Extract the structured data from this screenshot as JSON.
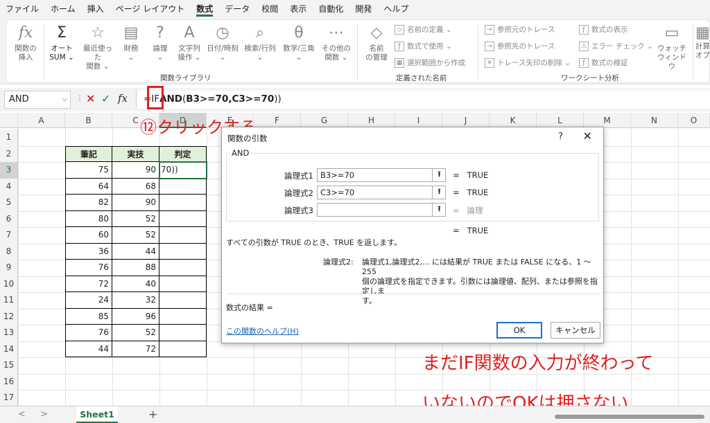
{
  "menu": [
    "ファイル",
    "ホーム",
    "挿入",
    "ページ レイアウト",
    "数式",
    "データ",
    "校閲",
    "表示",
    "自動化",
    "開発",
    "ヘルプ"
  ],
  "ribbon": {
    "insert_fn": [
      "関数の",
      "挿入"
    ],
    "autosum": [
      "オート",
      "SUM ⌄"
    ],
    "recent": [
      "最近使った",
      "関数 ⌄"
    ],
    "finance": [
      "財務",
      "⌄"
    ],
    "logic": [
      "論理",
      "⌄"
    ],
    "text": [
      "文字列",
      "操作 ⌄"
    ],
    "datetime": [
      "日付/時刻",
      "⌄"
    ],
    "lookup": [
      "検索/行列",
      "⌄"
    ],
    "math": [
      "数学/三角",
      "⌄"
    ],
    "other": [
      "その他の",
      "関数 ⌄"
    ],
    "group_library": "関数ライブラリ",
    "name_mgr": [
      "名前",
      "の管理"
    ],
    "define_name": "名前の定義 ⌄",
    "use_in_formula": "数式で使用 ⌄",
    "create_from_sel": "選択範囲から作成",
    "group_names": "定義された名前",
    "trace_prec": "参照元のトレース",
    "trace_dep": "参照先のトレース",
    "remove_arrows": "トレース矢印の削除 ⌄",
    "show_formulas": "数式の表示",
    "error_check": "エラー チェック ⌄",
    "eval_formula": "数式の検証",
    "group_audit": "ワークシート分析",
    "watch": [
      "ウォッチ",
      "ウィンドウ"
    ],
    "calc": [
      "計算",
      "オプ"
    ]
  },
  "formula_bar": {
    "name_box": "AND",
    "prefix": "=IF",
    "bold_part": "AND",
    "paren_open": "(",
    "args": "B3>=70,C3>=70",
    "paren_close": "))"
  },
  "columns": [
    "A",
    "B",
    "C",
    "D",
    "E",
    "F",
    "G",
    "H",
    "I",
    "J",
    "K",
    "L",
    "M",
    "N",
    "O"
  ],
  "rows": [
    "1",
    "2",
    "3",
    "4",
    "5",
    "6",
    "7",
    "8",
    "9",
    "10",
    "11",
    "12",
    "13",
    "14",
    "15",
    "16",
    "17"
  ],
  "table": {
    "headers": [
      "筆記",
      "実技",
      "判定"
    ],
    "d3_value": "70))",
    "data": [
      [
        75,
        90
      ],
      [
        64,
        68
      ],
      [
        82,
        90
      ],
      [
        80,
        52
      ],
      [
        60,
        52
      ],
      [
        36,
        44
      ],
      [
        76,
        88
      ],
      [
        72,
        40
      ],
      [
        24,
        32
      ],
      [
        85,
        96
      ],
      [
        76,
        52
      ],
      [
        44,
        72
      ]
    ]
  },
  "annotations": {
    "click": "⑫クリックする",
    "note_line1": "まだIF関数の入力が終わって",
    "note_line2": "いないのでOKは押さない"
  },
  "dialog": {
    "title": "関数の引数",
    "help_q": "?",
    "close": "✕",
    "function_name": "AND",
    "args": [
      {
        "label": "論理式1",
        "value": "B3>=70",
        "result": "TRUE"
      },
      {
        "label": "論理式2",
        "value": "C3>=70",
        "result": "TRUE"
      },
      {
        "label": "論理式3",
        "value": "",
        "result": "論理"
      }
    ],
    "eq": "=",
    "overall_result": "TRUE",
    "description": "すべての引数が TRUE のとき、TRUE を返します。",
    "arg_desc_label": "論理式2:",
    "arg_desc_line1": "論理式1,論理式2,... には結果が TRUE または FALSE になる、1 〜 255",
    "arg_desc_line2": "個の論理式を指定できます。引数には論理値、配列、または参照を指定しま",
    "arg_desc_line3": "す。",
    "formula_result": "数式の結果 =",
    "help_link": "この関数のヘルプ(H)",
    "ok": "OK",
    "cancel": "キャンセル"
  },
  "sheet_tabs": {
    "prev": "<",
    "next": ">",
    "active": "Sheet1",
    "add": "+"
  }
}
